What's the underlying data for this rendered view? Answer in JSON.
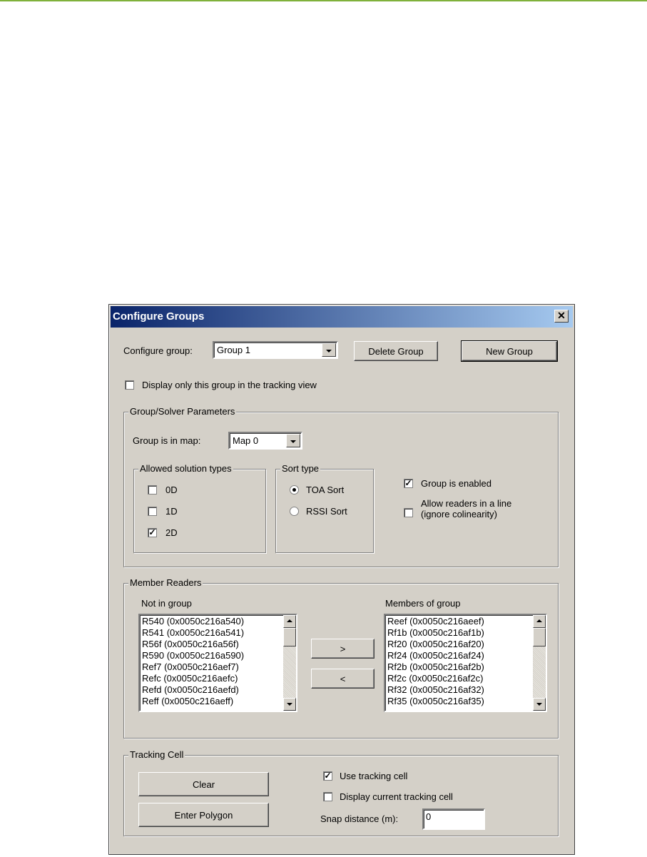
{
  "window": {
    "title": "Configure Groups",
    "close_label": "✕"
  },
  "top": {
    "configure_group_label": "Configure group:",
    "group_selected": "Group 1",
    "delete_button": "Delete Group",
    "new_button": "New Group",
    "display_only_label": "Display only this group in the tracking view",
    "display_only_checked": false
  },
  "solver": {
    "title": "Group/Solver Parameters",
    "map_label": "Group is in map:",
    "map_selected": "Map 0",
    "solution_types": {
      "title": "Allowed solution types",
      "items": [
        {
          "label": "0D",
          "checked": false
        },
        {
          "label": "1D",
          "checked": false
        },
        {
          "label": "2D",
          "checked": true
        }
      ]
    },
    "sort_type": {
      "title": "Sort type",
      "items": [
        {
          "label": "TOA Sort",
          "selected": true
        },
        {
          "label": "RSSI Sort",
          "selected": false
        }
      ]
    },
    "enabled_label": "Group is enabled",
    "enabled_checked": true,
    "colinear_label_line1": "Allow readers in a line",
    "colinear_label_line2": "(ignore colinearity)",
    "colinear_checked": false
  },
  "members": {
    "title": "Member Readers",
    "not_in_group_label": "Not in group",
    "members_label": "Members of group",
    "add_button": ">",
    "remove_button": "<",
    "not_in_group": [
      "R540 (0x0050c216a540)",
      "R541 (0x0050c216a541)",
      "R56f (0x0050c216a56f)",
      "R590 (0x0050c216a590)",
      "Ref7 (0x0050c216aef7)",
      "Refc (0x0050c216aefc)",
      "Refd (0x0050c216aefd)",
      "Reff (0x0050c216aeff)"
    ],
    "in_group": [
      "Reef (0x0050c216aeef)",
      "Rf1b (0x0050c216af1b)",
      "Rf20 (0x0050c216af20)",
      "Rf24 (0x0050c216af24)",
      "Rf2b (0x0050c216af2b)",
      "Rf2c (0x0050c216af2c)",
      "Rf32 (0x0050c216af32)",
      "Rf35 (0x0050c216af35)"
    ]
  },
  "tracking": {
    "title": "Tracking Cell",
    "clear_button": "Clear",
    "polygon_button": "Enter Polygon",
    "use_label": "Use tracking cell",
    "use_checked": true,
    "display_label": "Display current tracking cell",
    "display_checked": false,
    "snap_label": "Snap distance (m):",
    "snap_value": "0"
  },
  "colors": {
    "titlebar_start": "#0a246a",
    "titlebar_end": "#a6caf0",
    "dialog_bg": "#d4d0c8",
    "top_line": "#7fb13a"
  }
}
